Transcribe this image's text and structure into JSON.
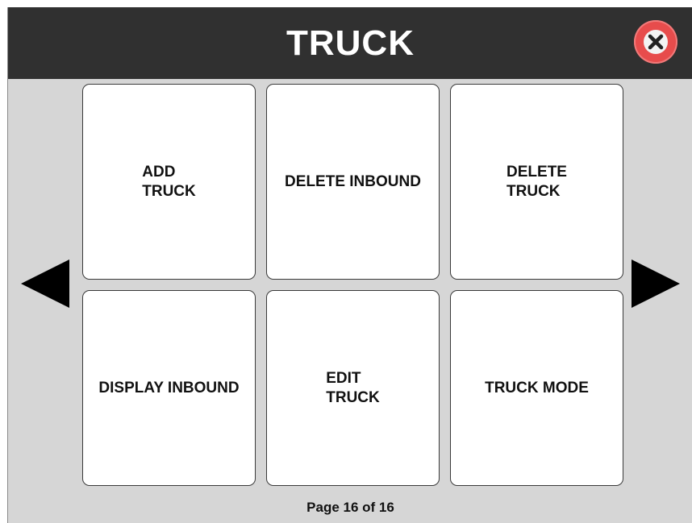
{
  "header": {
    "title": "TRUCK",
    "close_icon": "close-x-icon",
    "close_color": "#e74c4c"
  },
  "tiles": [
    {
      "label": "ADD\nTRUCK"
    },
    {
      "label": "DELETE INBOUND"
    },
    {
      "label": "DELETE\nTRUCK"
    },
    {
      "label": "DISPLAY INBOUND"
    },
    {
      "label": "EDIT\nTRUCK"
    },
    {
      "label": "TRUCK MODE"
    }
  ],
  "navigation": {
    "prev_icon": "left-arrow-icon",
    "next_icon": "right-arrow-icon"
  },
  "footer": {
    "page_text": "Page 16 of 16"
  }
}
